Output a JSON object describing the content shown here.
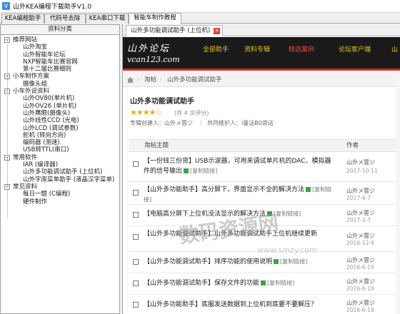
{
  "window": {
    "title": "山外KEA编程下载助手V1.0",
    "icon": "app-icon"
  },
  "tabs": [
    {
      "label": "KEA编程助手",
      "active": false
    },
    {
      "label": "代码号去除",
      "active": false
    },
    {
      "label": "KEA串口下载",
      "active": false
    },
    {
      "label": "智能车制作教程",
      "active": true
    }
  ],
  "sidebar": {
    "header": "资料分类",
    "groups": [
      {
        "label": "推荐网站",
        "items": [
          "山外淘宝",
          "山外智能车论坛",
          "NXP智能车比赛官网",
          "第十二届比赛细则"
        ]
      },
      {
        "label": "小车制作方案",
        "items": [
          "摄像头组"
        ]
      },
      {
        "label": "小车外设资料",
        "items": [
          "山外OV80(单片机)",
          "山外OV26 (单片机)",
          "山外鹰眼(摄像头)",
          "山外线性CCD (光电)",
          "山外LCD (调试参数)",
          "舵机 (转向方向)",
          "编码器 (测速)",
          "USB转TTL(串口)"
        ]
      },
      {
        "label": "常用软件",
        "items": [
          "IAR (编译器)",
          "山外多功能调试助手 (上位机)",
          "山外字库菜单助手 (液晶汉字菜单)"
        ]
      },
      {
        "label": "常见资料",
        "items": [
          "每日一题 (C编程)",
          "硬件制作"
        ]
      }
    ]
  },
  "browser": {
    "tab_label": "山外多功能调试助手 (上位机)",
    "close_icon": "close-icon",
    "site": {
      "logo_text": "山外论坛",
      "logo_url": "vcan123.com",
      "nav": [
        "全部助手",
        "资料专辑",
        "精选案例",
        "论坛客户端",
        "山"
      ],
      "current_nav": "精选案例"
    },
    "breadcrumb": [
      "淘帖",
      "山外多功能调试助手"
    ],
    "thread": {
      "title": "山外多功能调试助手",
      "stars": "★★★★☆",
      "rating": "(共 4 次评分)",
      "creator": "专辑创建人：山外メ雲ジ",
      "maintainer": "共同维护人：i童话B0浪话",
      "separator": "|"
    },
    "list_header": {
      "title": "淘帖主题",
      "author": "作者"
    },
    "rows": [
      {
        "title": "【一份钱三份货】USB示波器，可用来调试单片机的DAC、模拟器件的信号输出",
        "copy": "[复制链接]",
        "author": "山外メ雲ジ",
        "date": "2017-10-11"
      },
      {
        "title": "【山外多功能助手】高分屏下，界面显示不全的解决方法",
        "copy": "[复制链接]",
        "author": "山外メ雲ジ",
        "date": "2017-4-7"
      },
      {
        "title": "【电脑高分屏下上位机没法显示的解决方法",
        "copy": "[复制链接]",
        "author": "山外メ雲ジ",
        "date": "2017-3-7"
      },
      {
        "title": "【山外多功能调试助手】山外多功能调试助手上位机继续更新",
        "copy": "",
        "author": "山外メ雲ジ",
        "date": "2016-12-9"
      },
      {
        "title": "【山外多功能调试助手】排序功能的使用说明",
        "copy": "[复制链接]",
        "author": "山外メ雲ジ",
        "date": "2016-6-19"
      },
      {
        "title": "【山外多功能调试助手】保存文件的功能",
        "copy": "[复制链接]",
        "author": "山外メ雲ジ",
        "date": "2016-6-19"
      },
      {
        "title": "【山外多功能助手】底服发送数据到上位机到底要不要解压？",
        "copy": "",
        "author": "山外メ雲ジ",
        "date": "2016-6-19"
      }
    ]
  },
  "watermark": {
    "text": "数码资源网",
    "url": "www.smzy.com"
  },
  "colors": {
    "accent_red": "#d12a1e",
    "nav_yellow": "#e8c21a",
    "star": "#f2a800",
    "header_bg": "#1a1a1a"
  }
}
